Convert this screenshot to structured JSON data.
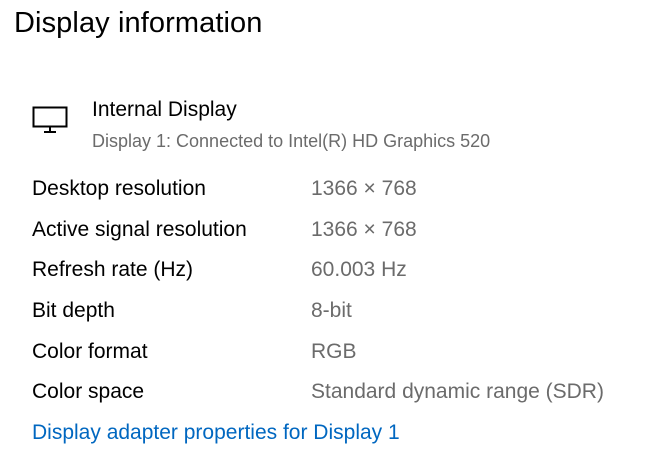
{
  "page": {
    "title": "Display information"
  },
  "display": {
    "icon": "monitor-icon",
    "name": "Internal Display",
    "subtitle": "Display 1: Connected to Intel(R) HD Graphics 520"
  },
  "info": [
    {
      "label": "Desktop resolution",
      "value": "1366 × 768"
    },
    {
      "label": "Active signal resolution",
      "value": "1366 × 768"
    },
    {
      "label": "Refresh rate (Hz)",
      "value": "60.003 Hz"
    },
    {
      "label": "Bit depth",
      "value": "8-bit"
    },
    {
      "label": "Color format",
      "value": "RGB"
    },
    {
      "label": "Color space",
      "value": "Standard dynamic range (SDR)"
    }
  ],
  "links": {
    "adapter_properties": "Display adapter properties for Display 1"
  },
  "colors": {
    "link": "#0067c0",
    "secondary_text": "#6b6b6b",
    "primary_text": "#000000"
  }
}
